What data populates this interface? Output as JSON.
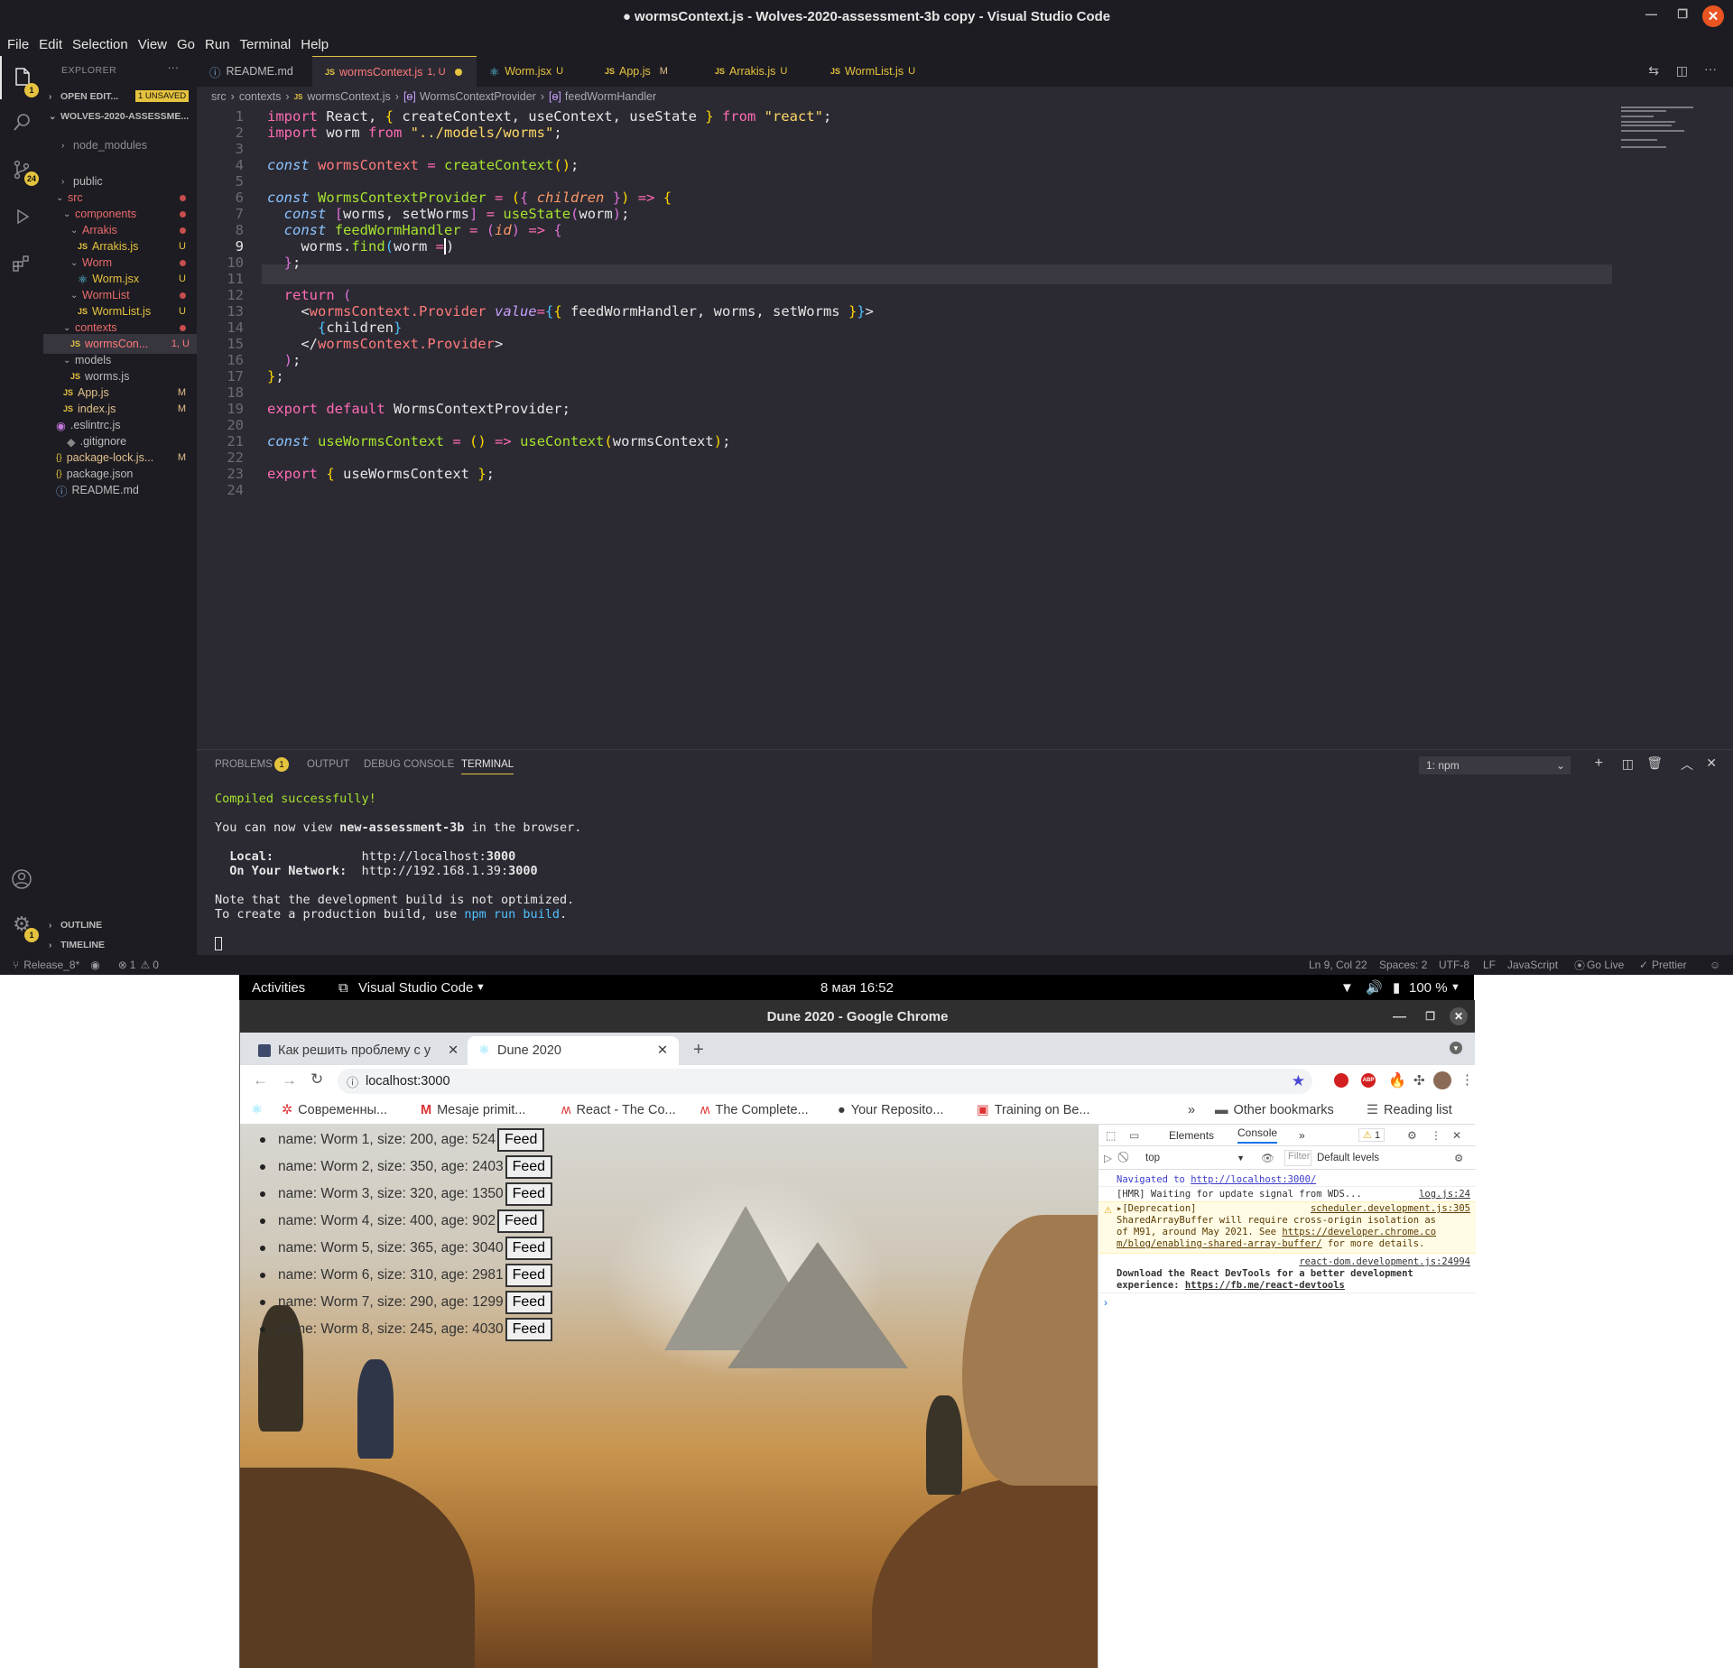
{
  "vscode": {
    "title": "● wormsContext.js - Wolves-2020-assessment-3b copy - Visual Studio Code",
    "menu": [
      "File",
      "Edit",
      "Selection",
      "View",
      "Go",
      "Run",
      "Terminal",
      "Help"
    ],
    "activity_badges": {
      "explorer": "1",
      "scm": "24",
      "settings": "1"
    },
    "explorer": {
      "header": "EXPLORER",
      "open_editors": "OPEN EDIT...",
      "unsaved": "1 UNSAVED",
      "folder": "WOLVES-2020-ASSESSME...",
      "tree": [
        {
          "label": "node_modules",
          "status": ""
        },
        {
          "label": "public",
          "status": ""
        },
        {
          "label": "src",
          "status": "dot"
        },
        {
          "label": "components",
          "status": "dot"
        },
        {
          "label": "Arrakis",
          "status": "dot"
        },
        {
          "label": "Arrakis.js",
          "status": "U"
        },
        {
          "label": "Worm",
          "status": "dot"
        },
        {
          "label": "Worm.jsx",
          "status": "U"
        },
        {
          "label": "WormList",
          "status": "dot"
        },
        {
          "label": "WormList.js",
          "status": "U"
        },
        {
          "label": "contexts",
          "status": "dot"
        },
        {
          "label": "wormsCon...",
          "status": "1, U"
        },
        {
          "label": "models",
          "status": ""
        },
        {
          "label": "worms.js",
          "status": ""
        },
        {
          "label": "App.js",
          "status": "M"
        },
        {
          "label": "index.js",
          "status": "M"
        },
        {
          "label": ".eslintrc.js",
          "status": ""
        },
        {
          "label": ".gitignore",
          "status": ""
        },
        {
          "label": "package-lock.js...",
          "status": "M"
        },
        {
          "label": "package.json",
          "status": ""
        },
        {
          "label": "README.md",
          "status": ""
        }
      ],
      "outline": "OUTLINE",
      "timeline": "TIMELINE"
    },
    "tabs": [
      {
        "label": "README.md",
        "status": ""
      },
      {
        "label": "wormsContext.js",
        "status": "1, U"
      },
      {
        "label": "Worm.jsx",
        "status": "U"
      },
      {
        "label": "App.js",
        "status": "M"
      },
      {
        "label": "Arrakis.js",
        "status": "U"
      },
      {
        "label": "WormList.js",
        "status": "U"
      }
    ],
    "breadcrumb": [
      "src",
      "contexts",
      "wormsContext.js",
      "WormsContextProvider",
      "feedWormHandler"
    ],
    "line_numbers": [
      "1",
      "2",
      "3",
      "4",
      "5",
      "6",
      "7",
      "8",
      "9",
      "10",
      "11",
      "12",
      "13",
      "14",
      "15",
      "16",
      "17",
      "18",
      "19",
      "20",
      "21",
      "22",
      "23",
      "24"
    ],
    "panel": {
      "tabs": [
        "PROBLEMS",
        "OUTPUT",
        "DEBUG CONSOLE",
        "TERMINAL"
      ],
      "problems_count": "1",
      "terminal_select": "1: npm",
      "compiled": "Compiled successfully!",
      "view_pre": "You can now view ",
      "app_name": "new-assessment-3b",
      "view_post": " in the browser.",
      "local_label": "Local:",
      "local_url": "http://localhost:",
      "local_port": "3000",
      "network_label": "On Your Network:",
      "network_url": "http://192.168.1.39:",
      "network_port": "3000",
      "note1": "Note that the development build is not optimized.",
      "note2_pre": "To create a production build, use ",
      "note2_cmd": "npm run build",
      "note2_post": "."
    },
    "status": {
      "branch": "Release_8*",
      "errors": "1",
      "warnings": "0",
      "position": "Ln 9, Col 22",
      "spaces": "Spaces: 2",
      "encoding": "UTF-8",
      "eol": "LF",
      "language": "JavaScript",
      "golive": "Go Live",
      "prettier": "Prettier"
    }
  },
  "gnome": {
    "activities": "Activities",
    "app": "Visual Studio Code",
    "clock": "8 мая  16:52",
    "battery": "100 %"
  },
  "chrome": {
    "title": "Dune 2020 - Google Chrome",
    "tabs": [
      "Как решить проблему с у",
      "Dune 2020"
    ],
    "url": "localhost:3000",
    "bookmarks": [
      "Современны...",
      "Mesaje primit...",
      "React - The Co...",
      "The Complete...",
      "Your Reposito...",
      "Training on Be..."
    ],
    "other_bookmarks": "Other bookmarks",
    "reading_list": "Reading list",
    "worms": [
      "name: Worm 1, size: 200, age: 524",
      "name: Worm 2, size: 350, age: 2403",
      "name: Worm 3, size: 320, age: 1350",
      "name: Worm 4, size: 400, age: 902",
      "name: Worm 5, size: 365, age: 3040",
      "name: Worm 6, size: 310, age: 2981",
      "name: Worm 7, size: 290, age: 1299",
      "name: Worm 8, size: 245, age: 4030"
    ],
    "feed_label": "Feed",
    "devtools": {
      "tabs": [
        "Elements",
        "Console"
      ],
      "warn_count": "1",
      "context": "top",
      "filter_placeholder": "Filter",
      "levels": "Default levels",
      "nav_text": "Navigated to ",
      "nav_url": "http://localhost:3000/",
      "hmr": "[HMR] Waiting for update signal from WDS...",
      "hmr_src": "log.js:24",
      "dep_title": "[Deprecation]",
      "dep_src": "scheduler.development.js:305",
      "dep_line1": "SharedArrayBuffer will require cross-origin isolation as",
      "dep_line2_pre": "of M91, around May 2021. See ",
      "dep_line2_link": "https://developer.chrome.co",
      "dep_line3_link": "m/blog/enabling-shared-array-buffer/",
      "dep_line3_post": " for more details.",
      "react_src": "react-dom.development.js:24994",
      "react_line1": "Download the React DevTools for a better development",
      "react_line2_pre": "experience: ",
      "react_line2_link": "https://fb.me/react-devtools"
    }
  }
}
